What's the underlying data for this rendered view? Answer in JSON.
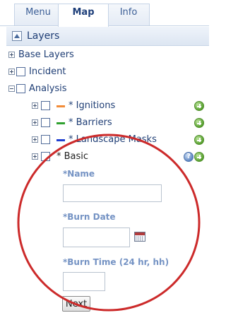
{
  "tabs": [
    {
      "label": "Menu"
    },
    {
      "label": "Map"
    },
    {
      "label": "Info"
    }
  ],
  "panel": {
    "title": "Layers"
  },
  "tree": {
    "base_layers": "Base Layers",
    "incident": "Incident",
    "analysis": "Analysis",
    "ignitions": "* Ignitions",
    "barriers": "* Barriers",
    "landscape_masks": "* Landscape Masks",
    "basic": "* Basic"
  },
  "form": {
    "name_label": "*Name",
    "name_value": "",
    "burn_date_label": "*Burn Date",
    "burn_date_value": "",
    "burn_time_label": "*Burn Time (24 hr, hh)",
    "burn_time_value": "",
    "next_label": "Next"
  },
  "colors": {
    "ignitions_swatch": "#f28c38",
    "barriers_swatch": "#2fa12f",
    "landscape_masks_swatch": "#1f3fd1",
    "highlight_circle": "#cc2a2a"
  },
  "icons": {
    "panel_icon": "layers-panel-icon",
    "add": "add-layer-icon",
    "help": "help-icon",
    "calendar": "calendar-icon"
  }
}
